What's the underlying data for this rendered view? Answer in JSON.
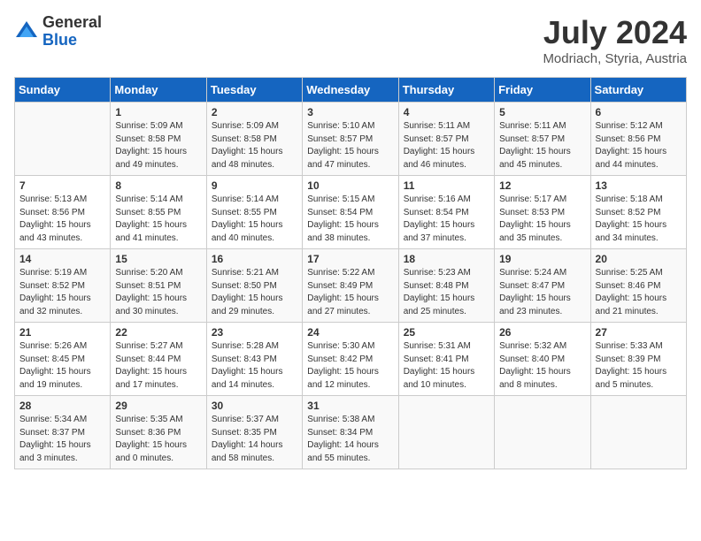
{
  "logo": {
    "general": "General",
    "blue": "Blue"
  },
  "title": "July 2024",
  "subtitle": "Modriach, Styria, Austria",
  "days_of_week": [
    "Sunday",
    "Monday",
    "Tuesday",
    "Wednesday",
    "Thursday",
    "Friday",
    "Saturday"
  ],
  "weeks": [
    [
      {
        "num": "",
        "sunrise": "",
        "sunset": "",
        "daylight": ""
      },
      {
        "num": "1",
        "sunrise": "Sunrise: 5:09 AM",
        "sunset": "Sunset: 8:58 PM",
        "daylight": "Daylight: 15 hours and 49 minutes."
      },
      {
        "num": "2",
        "sunrise": "Sunrise: 5:09 AM",
        "sunset": "Sunset: 8:58 PM",
        "daylight": "Daylight: 15 hours and 48 minutes."
      },
      {
        "num": "3",
        "sunrise": "Sunrise: 5:10 AM",
        "sunset": "Sunset: 8:57 PM",
        "daylight": "Daylight: 15 hours and 47 minutes."
      },
      {
        "num": "4",
        "sunrise": "Sunrise: 5:11 AM",
        "sunset": "Sunset: 8:57 PM",
        "daylight": "Daylight: 15 hours and 46 minutes."
      },
      {
        "num": "5",
        "sunrise": "Sunrise: 5:11 AM",
        "sunset": "Sunset: 8:57 PM",
        "daylight": "Daylight: 15 hours and 45 minutes."
      },
      {
        "num": "6",
        "sunrise": "Sunrise: 5:12 AM",
        "sunset": "Sunset: 8:56 PM",
        "daylight": "Daylight: 15 hours and 44 minutes."
      }
    ],
    [
      {
        "num": "7",
        "sunrise": "Sunrise: 5:13 AM",
        "sunset": "Sunset: 8:56 PM",
        "daylight": "Daylight: 15 hours and 43 minutes."
      },
      {
        "num": "8",
        "sunrise": "Sunrise: 5:14 AM",
        "sunset": "Sunset: 8:55 PM",
        "daylight": "Daylight: 15 hours and 41 minutes."
      },
      {
        "num": "9",
        "sunrise": "Sunrise: 5:14 AM",
        "sunset": "Sunset: 8:55 PM",
        "daylight": "Daylight: 15 hours and 40 minutes."
      },
      {
        "num": "10",
        "sunrise": "Sunrise: 5:15 AM",
        "sunset": "Sunset: 8:54 PM",
        "daylight": "Daylight: 15 hours and 38 minutes."
      },
      {
        "num": "11",
        "sunrise": "Sunrise: 5:16 AM",
        "sunset": "Sunset: 8:54 PM",
        "daylight": "Daylight: 15 hours and 37 minutes."
      },
      {
        "num": "12",
        "sunrise": "Sunrise: 5:17 AM",
        "sunset": "Sunset: 8:53 PM",
        "daylight": "Daylight: 15 hours and 35 minutes."
      },
      {
        "num": "13",
        "sunrise": "Sunrise: 5:18 AM",
        "sunset": "Sunset: 8:52 PM",
        "daylight": "Daylight: 15 hours and 34 minutes."
      }
    ],
    [
      {
        "num": "14",
        "sunrise": "Sunrise: 5:19 AM",
        "sunset": "Sunset: 8:52 PM",
        "daylight": "Daylight: 15 hours and 32 minutes."
      },
      {
        "num": "15",
        "sunrise": "Sunrise: 5:20 AM",
        "sunset": "Sunset: 8:51 PM",
        "daylight": "Daylight: 15 hours and 30 minutes."
      },
      {
        "num": "16",
        "sunrise": "Sunrise: 5:21 AM",
        "sunset": "Sunset: 8:50 PM",
        "daylight": "Daylight: 15 hours and 29 minutes."
      },
      {
        "num": "17",
        "sunrise": "Sunrise: 5:22 AM",
        "sunset": "Sunset: 8:49 PM",
        "daylight": "Daylight: 15 hours and 27 minutes."
      },
      {
        "num": "18",
        "sunrise": "Sunrise: 5:23 AM",
        "sunset": "Sunset: 8:48 PM",
        "daylight": "Daylight: 15 hours and 25 minutes."
      },
      {
        "num": "19",
        "sunrise": "Sunrise: 5:24 AM",
        "sunset": "Sunset: 8:47 PM",
        "daylight": "Daylight: 15 hours and 23 minutes."
      },
      {
        "num": "20",
        "sunrise": "Sunrise: 5:25 AM",
        "sunset": "Sunset: 8:46 PM",
        "daylight": "Daylight: 15 hours and 21 minutes."
      }
    ],
    [
      {
        "num": "21",
        "sunrise": "Sunrise: 5:26 AM",
        "sunset": "Sunset: 8:45 PM",
        "daylight": "Daylight: 15 hours and 19 minutes."
      },
      {
        "num": "22",
        "sunrise": "Sunrise: 5:27 AM",
        "sunset": "Sunset: 8:44 PM",
        "daylight": "Daylight: 15 hours and 17 minutes."
      },
      {
        "num": "23",
        "sunrise": "Sunrise: 5:28 AM",
        "sunset": "Sunset: 8:43 PM",
        "daylight": "Daylight: 15 hours and 14 minutes."
      },
      {
        "num": "24",
        "sunrise": "Sunrise: 5:30 AM",
        "sunset": "Sunset: 8:42 PM",
        "daylight": "Daylight: 15 hours and 12 minutes."
      },
      {
        "num": "25",
        "sunrise": "Sunrise: 5:31 AM",
        "sunset": "Sunset: 8:41 PM",
        "daylight": "Daylight: 15 hours and 10 minutes."
      },
      {
        "num": "26",
        "sunrise": "Sunrise: 5:32 AM",
        "sunset": "Sunset: 8:40 PM",
        "daylight": "Daylight: 15 hours and 8 minutes."
      },
      {
        "num": "27",
        "sunrise": "Sunrise: 5:33 AM",
        "sunset": "Sunset: 8:39 PM",
        "daylight": "Daylight: 15 hours and 5 minutes."
      }
    ],
    [
      {
        "num": "28",
        "sunrise": "Sunrise: 5:34 AM",
        "sunset": "Sunset: 8:37 PM",
        "daylight": "Daylight: 15 hours and 3 minutes."
      },
      {
        "num": "29",
        "sunrise": "Sunrise: 5:35 AM",
        "sunset": "Sunset: 8:36 PM",
        "daylight": "Daylight: 15 hours and 0 minutes."
      },
      {
        "num": "30",
        "sunrise": "Sunrise: 5:37 AM",
        "sunset": "Sunset: 8:35 PM",
        "daylight": "Daylight: 14 hours and 58 minutes."
      },
      {
        "num": "31",
        "sunrise": "Sunrise: 5:38 AM",
        "sunset": "Sunset: 8:34 PM",
        "daylight": "Daylight: 14 hours and 55 minutes."
      },
      {
        "num": "",
        "sunrise": "",
        "sunset": "",
        "daylight": ""
      },
      {
        "num": "",
        "sunrise": "",
        "sunset": "",
        "daylight": ""
      },
      {
        "num": "",
        "sunrise": "",
        "sunset": "",
        "daylight": ""
      }
    ]
  ]
}
